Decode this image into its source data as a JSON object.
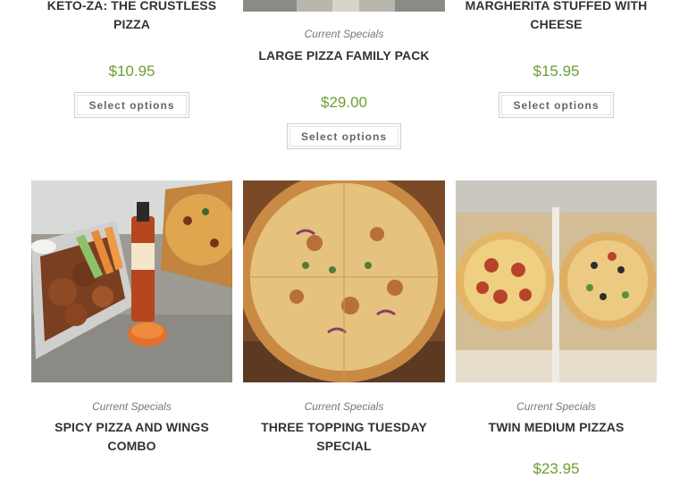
{
  "products": [
    {
      "category": "",
      "title": "KETO-ZA: THE CRUSTLESS PIZZA",
      "price": "$10.95",
      "button": "Select options"
    },
    {
      "category": "Current Specials",
      "title": "LARGE PIZZA FAMILY PACK",
      "price": "$29.00",
      "button": "Select options"
    },
    {
      "category": "",
      "title": "MARGHERITA STUFFED WITH CHEESE",
      "price": "$15.95",
      "button": "Select options"
    },
    {
      "category": "Current Specials",
      "title": "SPICY PIZZA AND WINGS COMBO",
      "price": "",
      "button": ""
    },
    {
      "category": "Current Specials",
      "title": "THREE TOPPING TUESDAY SPECIAL",
      "price": "",
      "button": ""
    },
    {
      "category": "Current Specials",
      "title": "TWIN MEDIUM PIZZAS",
      "price": "$23.95",
      "button": ""
    }
  ],
  "colors": {
    "price": "#6b9f32",
    "title": "#333333",
    "category": "#777777"
  }
}
